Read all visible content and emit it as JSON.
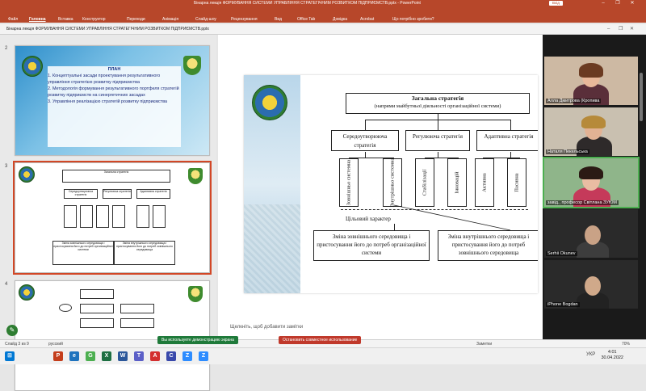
{
  "window": {
    "title": "Бінарна лекція ФОРМУВАННЯ СИСТЕМИ УПРАВЛІННЯ СТРАТЕГІЧНИМ РОЗВИТКОМ ПІДПРИЄМСТВ.pptx - PowerPoint",
    "signin": "Вхід",
    "minimize": "–",
    "restore": "❐",
    "close": "✕"
  },
  "ribbon": {
    "tabs": [
      "Файл",
      "Головна",
      "Вставка",
      "Конструктор",
      "Переходи",
      "Анімація",
      "Слайд-шоу",
      "Рецензування",
      "Вид",
      "Office Tab",
      "Довідка",
      "Acrobat",
      "Що потрібно зробити?"
    ],
    "active_index": 1
  },
  "document": {
    "name": "Бінарна лекція ФОРМУВАННЯ СИСТЕМИ УПРАВЛІННЯ СТРАТЕГІЧНИМ РОЗВИТКОМ ПІДПРИЄМСТВ.pptx",
    "controls": [
      "–",
      "❐",
      "✕"
    ]
  },
  "thumbnails": {
    "numbers": [
      "2",
      "3",
      "4"
    ],
    "slide2": {
      "title": "ПЛАН",
      "items": [
        "1. Концептуальні засади проектування результативного управління стратегією розвитку підприємства",
        "2. Методологія формування результативного портфеля стратегій розвитку підприємств на синергетичних засадах",
        "3. Управління реалізацією стратегій розвитку підприємства"
      ]
    }
  },
  "slide": {
    "top": "Загальна стратегія",
    "top_sub": "(напрями майбутньої діяльності організаційної системи)",
    "mid": [
      "Середоутворююча стратегія",
      "Регулююча стратегія",
      "Адаптивна стратегія"
    ],
    "vertical": [
      "Зовнішньо системна",
      "Внутрішньо системна",
      "Стабілізації",
      "Інновацій",
      "Активна",
      "Пасивна"
    ],
    "target": "Цільовий характер",
    "bottom_left": "Зміна зовнішнього середовища і пристосування його до потреб організаційної системи",
    "bottom_right": "Зміна внутрішнього середовища і пристосування його до потреб зовнішнього середовища"
  },
  "notes": "Щелкніть, щоб добавити замітки",
  "participants": [
    {
      "name": "Алла Дмитрова (Кропива"
    },
    {
      "name": "Наталя Пекельська"
    },
    {
      "name": "завід., професор Світлана ЗУЮМ"
    },
    {
      "name": "Serhii Okunev"
    },
    {
      "name": "iPhone Bogdan"
    }
  ],
  "status": {
    "slide": "Слайд 3 из 9",
    "lang": "русский",
    "share_on": "Вы используете демонстрацию экрана",
    "share_off": "Остановить совместное использование",
    "notes_btn": "Заметки",
    "zoom": "70%"
  },
  "taskbar": {
    "icons": [
      "⊞",
      "P",
      "e",
      "G",
      "X",
      "W",
      "T",
      "A",
      "C",
      "Z",
      "Z"
    ],
    "time": "4:01",
    "date": "30.04.2022",
    "lang": "УКР"
  },
  "colors": {
    "accent": "#b7472a",
    "share_green": "#1f7a3a",
    "share_red": "#c0392b"
  }
}
